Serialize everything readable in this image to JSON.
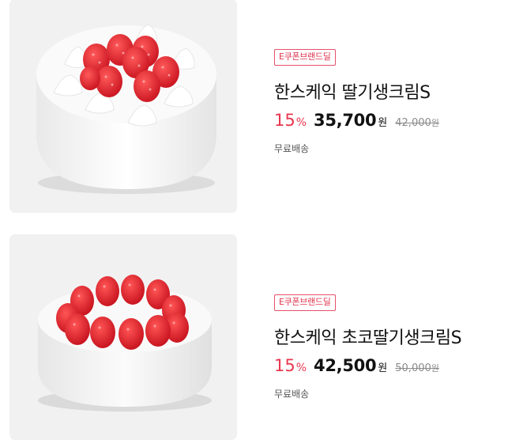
{
  "products": [
    {
      "badge": "E쿠폰브랜드딜",
      "title": "한스케익 딸기생크림S",
      "discount": "15",
      "discount_unit": "%",
      "price": "35,700",
      "price_unit": "원",
      "original_price": "42,000",
      "original_unit": "원",
      "shipping": "무료배송"
    },
    {
      "badge": "E쿠폰브랜드딜",
      "title": "한스케익 초코딸기생크림S",
      "discount": "15",
      "discount_unit": "%",
      "price": "42,500",
      "price_unit": "원",
      "original_price": "50,000",
      "original_unit": "원",
      "shipping": "무료배송"
    }
  ],
  "colors": {
    "accent": "#e8364f",
    "badge_border": "#e8506a",
    "thumb_bg": "#f1f1f1"
  }
}
